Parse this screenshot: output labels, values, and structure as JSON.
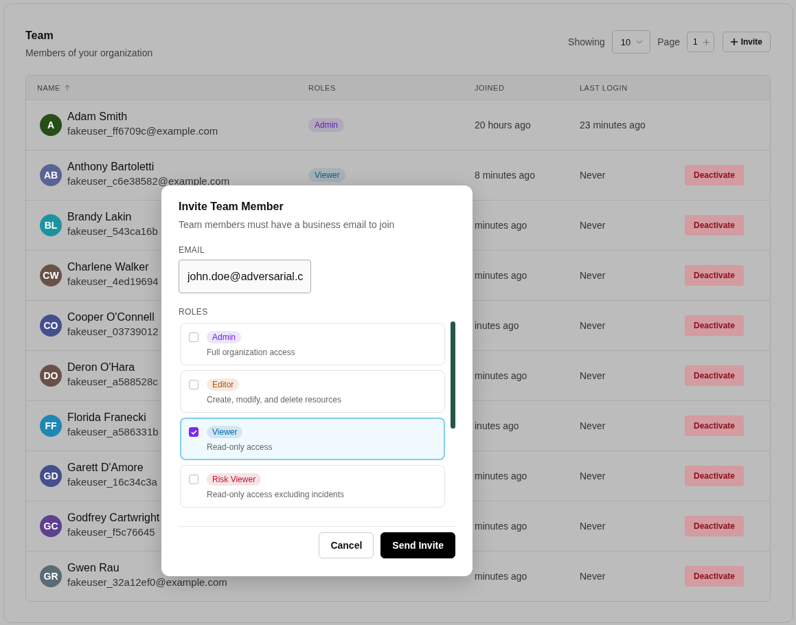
{
  "header": {
    "title": "Team",
    "subtitle": "Members of your organization",
    "showing_label": "Showing",
    "page_size": "10",
    "page_label": "Page",
    "page": "1",
    "invite_button": "Invite"
  },
  "table": {
    "columns": [
      {
        "label": "NAME",
        "sorted": true
      },
      {
        "label": "ROLES"
      },
      {
        "label": "JOINED"
      },
      {
        "label": "LAST LOGIN"
      }
    ],
    "rows": [
      {
        "initials": "A",
        "color": "#264e16",
        "name": "Adam Smith",
        "email": "fakeuser_ff6709c@example.com",
        "role": {
          "label": "Admin",
          "color": "#5a21b0"
        },
        "joined": "20 hours ago",
        "last_login": "23 minutes ago"
      },
      {
        "initials": "AB",
        "color": "#5a6396",
        "name": "Anthony Bartoletti",
        "email": "fakeuser_c6e38582@example.com",
        "role": {
          "label": "Viewer",
          "color": "#0b5b8a"
        },
        "joined": "8 minutes ago",
        "last_login": "Never",
        "action": "Deactivate"
      },
      {
        "initials": "BL",
        "color": "#1c93a1",
        "name": "Brandy Lakin",
        "email": "fakeuser_543ca16b",
        "joined": "minutes ago",
        "last_login": "Never",
        "action": "Deactivate"
      },
      {
        "initials": "CW",
        "color": "#685149",
        "name": "Charlene Walker",
        "email": "fakeuser_4ed19694",
        "joined": "minutes ago",
        "last_login": "Never",
        "action": "Deactivate"
      },
      {
        "initials": "CO",
        "color": "#444f8e",
        "name": "Cooper O'Connell",
        "email": "fakeuser_03739012",
        "joined": "inutes ago",
        "last_login": "Never",
        "action": "Deactivate"
      },
      {
        "initials": "DO",
        "color": "#685149",
        "name": "Deron O'Hara",
        "email": "fakeuser_a588528c",
        "joined": "minutes ago",
        "last_login": "Never",
        "action": "Deactivate"
      },
      {
        "initials": "FF",
        "color": "#1e87b6",
        "name": "Florida Franecki",
        "email": "fakeuser_a586331b",
        "joined": "inutes ago",
        "last_login": "Never",
        "action": "Deactivate"
      },
      {
        "initials": "GD",
        "color": "#444f8e",
        "name": "Garett D'Amore",
        "email": "fakeuser_16c34c3a",
        "joined": "minutes ago",
        "last_login": "Never",
        "action": "Deactivate"
      },
      {
        "initials": "GC",
        "color": "#5d4090",
        "name": "Godfrey Cartwright",
        "email": "fakeuser_f5c76645",
        "joined": "minutes ago",
        "last_login": "Never",
        "action": "Deactivate"
      },
      {
        "initials": "GR",
        "color": "#596b73",
        "name": "Gwen Rau",
        "email": "fakeuser_32a12ef0@example.com",
        "joined": "minutes ago",
        "last_login": "Never",
        "action": "Deactivate"
      }
    ]
  },
  "modal": {
    "title": "Invite Team Member",
    "subtitle": "Team members must have a business email to join",
    "email_label": "EMAIL",
    "email_value": "john.doe@adversarial.c",
    "roles_label": "ROLES",
    "roles": [
      {
        "label": "Admin",
        "color": "#6d28d9",
        "description": "Full organization access",
        "checked": false
      },
      {
        "label": "Editor",
        "color": "#b45309",
        "description": "Create, modify, and delete resources",
        "checked": false
      },
      {
        "label": "Viewer",
        "color": "#0369a1",
        "description": "Read-only access",
        "checked": true
      },
      {
        "label": "Risk Viewer",
        "color": "#c0152f",
        "description": "Read-only access excluding incidents",
        "checked": false
      }
    ],
    "cancel_button": "Cancel",
    "send_button": "Send Invite"
  }
}
